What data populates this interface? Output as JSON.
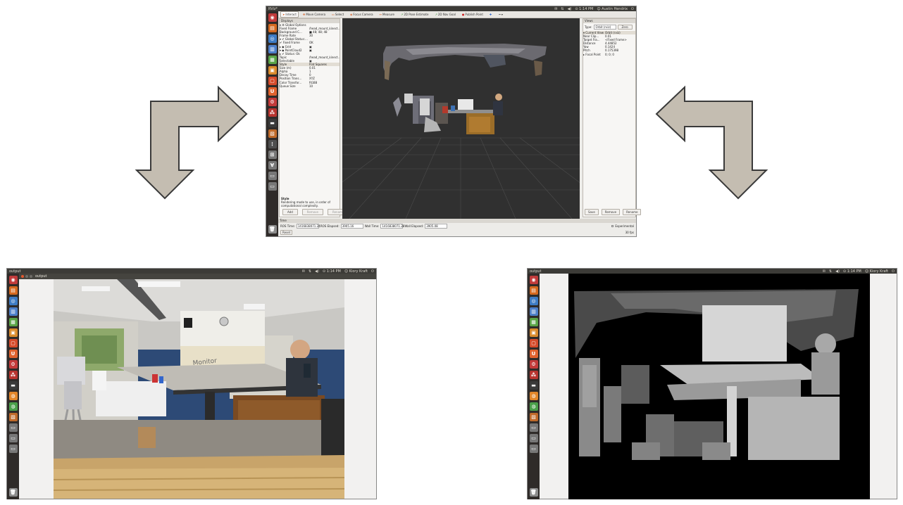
{
  "rviz": {
    "app_title": "RViz*",
    "indicators": [
      "✉",
      "⇅",
      "◀)",
      "⊙ 1:14 PM",
      "☺ Austin Hendrix"
    ],
    "toolbar": [
      {
        "label": "Interact",
        "active": true,
        "icon": "cursor-icon"
      },
      {
        "label": "Move Camera",
        "active": false,
        "icon": "move-camera-icon"
      },
      {
        "label": "Select",
        "active": false,
        "icon": "select-icon"
      },
      {
        "label": "Focus Camera",
        "active": false,
        "icon": "focus-icon"
      },
      {
        "label": "Measure",
        "active": false,
        "icon": "measure-icon"
      },
      {
        "label": "2D Pose Estimate",
        "active": false,
        "icon": "pose-arrow-icon"
      },
      {
        "label": "2D Nav Goal",
        "active": false,
        "icon": "nav-goal-icon"
      },
      {
        "label": "Publish Point",
        "active": false,
        "icon": "point-icon"
      }
    ],
    "displays": {
      "title": "Displays",
      "rows": [
        {
          "k": "▾ ⚙ Global Options",
          "v": ""
        },
        {
          "k": "      Fixed Frame",
          "v": "/head_mount_kinect..."
        },
        {
          "k": "      Background C...",
          "v": "■ 48; 48; 48"
        },
        {
          "k": "      Frame Rate",
          "v": "30"
        },
        {
          "k": "▾ ✔ Global Status:...",
          "v": ""
        },
        {
          "k": "      ✔ Fixed Frame",
          "v": "OK"
        },
        {
          "k": "▸ ◆ Grid",
          "v": "▣"
        },
        {
          "k": "▾ ◆ PointCloud2",
          "v": "▣"
        },
        {
          "k": "   ▸ ✔ Status: Ok",
          "v": ""
        },
        {
          "k": "      Topic",
          "v": "/head_mount_kinect..."
        },
        {
          "k": "      Selectable",
          "v": "▣"
        },
        {
          "k": "      Style",
          "v": "Flat Squares"
        },
        {
          "k": "      Size (m)",
          "v": "0.01"
        },
        {
          "k": "      Alpha",
          "v": "1"
        },
        {
          "k": "      Decay Time",
          "v": "0"
        },
        {
          "k": "      Position Trans...",
          "v": "XYZ"
        },
        {
          "k": "      Color Transfor...",
          "v": "RGB8"
        },
        {
          "k": "      Queue Size",
          "v": "10"
        }
      ],
      "desc_title": "Style",
      "desc_text": "Rendering mode to use, in order of computational complexity.",
      "buttons": [
        "Add",
        "Remove",
        "Rename"
      ]
    },
    "views": {
      "title": "Views",
      "type_label": "Type:",
      "type_value": "Orbit (rviz)",
      "zero_label": "Zero",
      "rows": [
        {
          "k": "▾ Current View",
          "v": "Orbit (rviz)"
        },
        {
          "k": "    Near Clip...",
          "v": "0.01"
        },
        {
          "k": "    Target Fra...",
          "v": "<Fixed Frame>"
        },
        {
          "k": "    Distance",
          "v": "4.44852"
        },
        {
          "k": "    Yaw",
          "v": "0.1424"
        },
        {
          "k": "    Pitch",
          "v": "0.175398"
        },
        {
          "k": " ▸ Focal Point",
          "v": "0; 0; 0"
        }
      ],
      "buttons": [
        "Save",
        "Remove",
        "Rename"
      ]
    },
    "time": {
      "title": "Time",
      "ros_time_label": "ROS Time:",
      "ros_time": "1416838071.24",
      "ros_elapsed_label": "ROS Elapsed:",
      "ros_elapsed": "3905.16",
      "wall_time_label": "Wall Time:",
      "wall_time": "1416838071.28",
      "wall_elapsed_label": "Wall Elapsed:",
      "wall_elapsed": "3905.08",
      "experimental_label": "Experimental",
      "reset_label": "Reset",
      "fps": "30 fps"
    }
  },
  "left_window": {
    "topbar_title": "output",
    "window_title": "output",
    "indicators": [
      "✉",
      "⇅",
      "◀)",
      "⊙ 1:14 PM",
      "☺ Kiory Kraft"
    ],
    "image_text": "Monitor"
  },
  "right_window": {
    "topbar_title": "output",
    "indicators": [
      "✉",
      "⇅",
      "◀)",
      "⊙ 1:14 PM",
      "☺ Kiory Kraft"
    ]
  },
  "colors": {
    "arrow_fill": "#c4bdb1",
    "arrow_stroke": "#3a3a3a",
    "ubuntu_bar": "#3c3b37",
    "launcher_bg": "#2f2b29",
    "rviz_bg": "#303030"
  }
}
